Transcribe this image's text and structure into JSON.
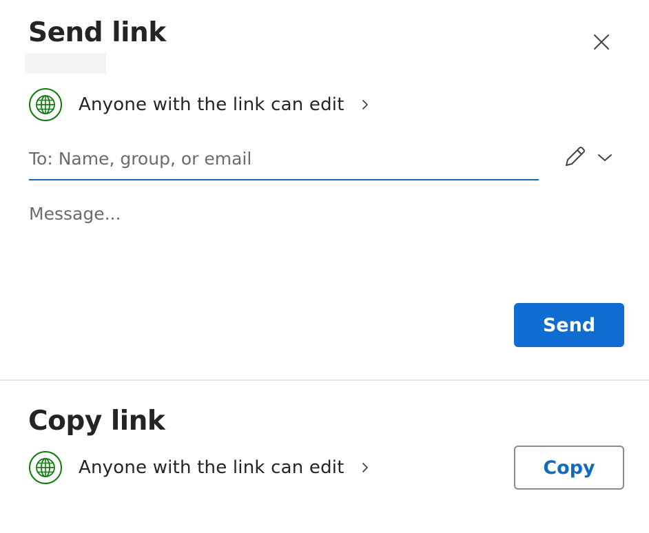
{
  "dialog": {
    "title": "Send link",
    "close_icon": "close-icon"
  },
  "send_section": {
    "permission": {
      "icon": "globe-icon",
      "label": "Anyone with the link can edit"
    },
    "to_field": {
      "placeholder": "To: Name, group, or email",
      "value": ""
    },
    "edit_permission_icon": "pencil-icon",
    "dropdown_icon": "chevron-down-icon",
    "message": {
      "placeholder": "Message...",
      "value": ""
    },
    "send_label": "Send"
  },
  "copy_section": {
    "title": "Copy link",
    "permission": {
      "icon": "globe-icon",
      "label": "Anyone with the link can edit"
    },
    "copy_label": "Copy"
  },
  "colors": {
    "accent": "#0f6cbd",
    "send_button": "#0f6cd0",
    "globe": "#107c10",
    "divider": "#e6e6e6"
  }
}
